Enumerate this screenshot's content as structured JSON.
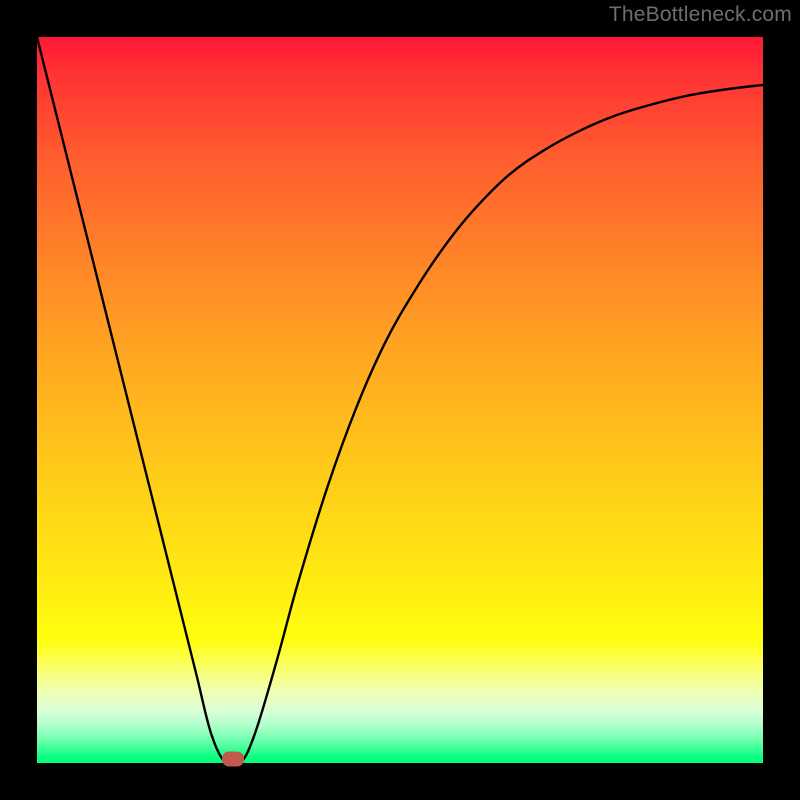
{
  "watermark": "TheBottleneck.com",
  "frame": {
    "border_px": 37,
    "inner_w": 726,
    "inner_h": 726
  },
  "chart_data": {
    "type": "line",
    "title": "",
    "xlabel": "",
    "ylabel": "",
    "xlim": [
      0,
      100
    ],
    "ylim": [
      0,
      100
    ],
    "grid": false,
    "legend": false,
    "series": [
      {
        "name": "bottleneck-curve",
        "x": [
          0,
          4,
          8,
          12,
          16,
          20,
          22,
          24,
          26,
          28,
          30,
          33,
          36,
          40,
          44,
          48,
          52,
          56,
          60,
          65,
          70,
          75,
          80,
          85,
          90,
          95,
          100
        ],
        "y": [
          100,
          84,
          68,
          52,
          36,
          20,
          12,
          4,
          0,
          0,
          4,
          14,
          25,
          38,
          49,
          58,
          65,
          71,
          76,
          81,
          84.5,
          87.2,
          89.3,
          90.8,
          92,
          92.8,
          93.4
        ],
        "stroke": "#000000",
        "stroke_width": 2.4
      }
    ],
    "marker": {
      "name": "optimal-point",
      "x": 27.0,
      "y": 0.6,
      "color": "#c1594d"
    },
    "background_gradient": {
      "direction": "top-to-bottom",
      "stops": [
        {
          "pos": 0.0,
          "color": "#ff1836"
        },
        {
          "pos": 0.42,
          "color": "#ffa222"
        },
        {
          "pos": 0.83,
          "color": "#ffff0e"
        },
        {
          "pos": 1.0,
          "color": "#00ff7c"
        }
      ]
    }
  }
}
